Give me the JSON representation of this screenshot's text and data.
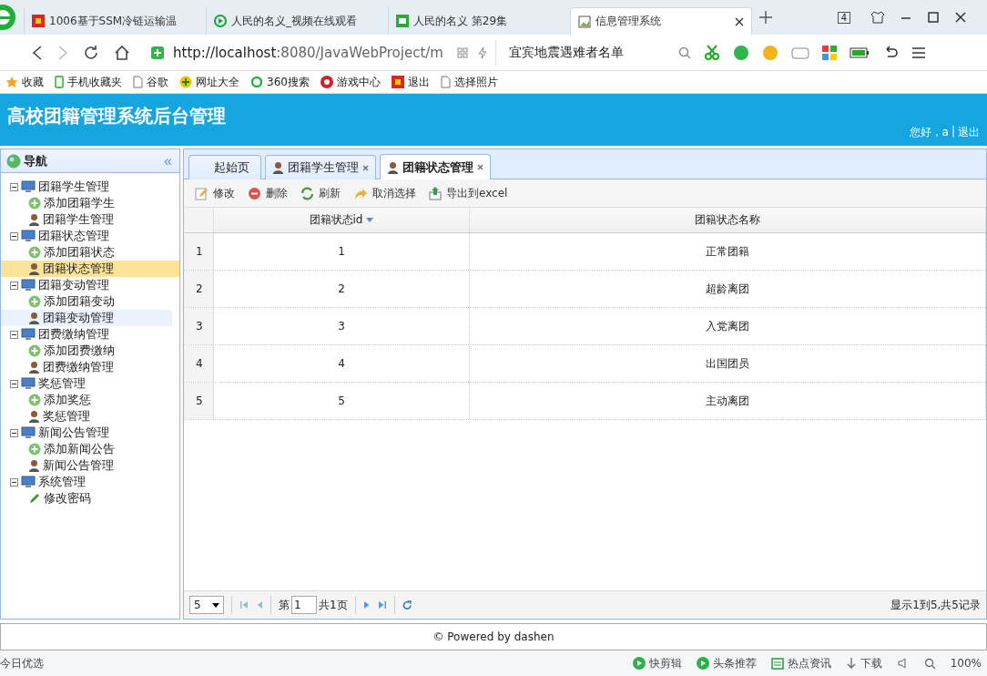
{
  "browser": {
    "tabs": [
      {
        "title": "1006基于SSM冷链运输温",
        "kind": "red",
        "selected": false
      },
      {
        "title": "人民的名义_视频在线观看",
        "kind": "play",
        "selected": false
      },
      {
        "title": "人民的名义 第29集",
        "kind": "green",
        "selected": false
      },
      {
        "title": "信息管理系统",
        "kind": "page",
        "selected": true
      }
    ],
    "tab_count": "4",
    "url_host": "http://localhost",
    "url_rest": ":8080/JavaWebProject/m",
    "search": "宜宾地震遇难者名单",
    "bookmarks": [
      {
        "label": "收藏",
        "kind": "star"
      },
      {
        "label": "手机收藏夹",
        "kind": "phone"
      },
      {
        "label": "谷歌",
        "kind": "doc"
      },
      {
        "label": "网址大全",
        "kind": "plus"
      },
      {
        "label": "360搜索",
        "kind": "ring"
      },
      {
        "label": "游戏中心",
        "kind": "game"
      },
      {
        "label": "退出",
        "kind": "red"
      },
      {
        "label": "选择照片",
        "kind": "doc"
      }
    ]
  },
  "header": {
    "title": "高校团籍管理系统后台管理",
    "greeting": "您好，a",
    "separator": "|",
    "logout": "退出"
  },
  "nav": {
    "title": "导航",
    "collapse": "«",
    "groups": [
      {
        "label": "团籍学生管理",
        "expanded": true,
        "children": [
          {
            "label": "添加团籍学生",
            "kind": "add",
            "selected": false,
            "hovered": false
          },
          {
            "label": "团籍学生管理",
            "kind": "manage",
            "selected": false,
            "hovered": false
          }
        ]
      },
      {
        "label": "团籍状态管理",
        "expanded": true,
        "children": [
          {
            "label": "添加团籍状态",
            "kind": "add",
            "selected": false,
            "hovered": false
          },
          {
            "label": "团籍状态管理",
            "kind": "manage",
            "selected": true,
            "hovered": false
          }
        ]
      },
      {
        "label": "团籍变动管理",
        "expanded": true,
        "children": [
          {
            "label": "添加团籍变动",
            "kind": "add",
            "selected": false,
            "hovered": false
          },
          {
            "label": "团籍变动管理",
            "kind": "manage",
            "selected": false,
            "hovered": true
          }
        ]
      },
      {
        "label": "团费缴纳管理",
        "expanded": true,
        "children": [
          {
            "label": "添加团费缴纳",
            "kind": "add",
            "selected": false,
            "hovered": false
          },
          {
            "label": "团费缴纳管理",
            "kind": "manage",
            "selected": false,
            "hovered": false
          }
        ]
      },
      {
        "label": "奖惩管理",
        "expanded": true,
        "children": [
          {
            "label": "添加奖惩",
            "kind": "add",
            "selected": false,
            "hovered": false
          },
          {
            "label": "奖惩管理",
            "kind": "manage",
            "selected": false,
            "hovered": false
          }
        ]
      },
      {
        "label": "新闻公告管理",
        "expanded": true,
        "children": [
          {
            "label": "添加新闻公告",
            "kind": "add",
            "selected": false,
            "hovered": false
          },
          {
            "label": "新闻公告管理",
            "kind": "manage",
            "selected": false,
            "hovered": false
          }
        ]
      },
      {
        "label": "系统管理",
        "expanded": true,
        "children": [
          {
            "label": "修改密码",
            "kind": "edit",
            "selected": false,
            "hovered": false
          }
        ]
      }
    ]
  },
  "tabs": [
    {
      "label": "起始页",
      "selected": false,
      "icon": false,
      "closable": false
    },
    {
      "label": "团籍学生管理",
      "selected": false,
      "icon": true,
      "closable": true
    },
    {
      "label": "团籍状态管理",
      "selected": true,
      "icon": true,
      "closable": true
    }
  ],
  "toolbar": [
    {
      "label": "修改",
      "kind": "edit"
    },
    {
      "label": "删除",
      "kind": "delete"
    },
    {
      "label": "刷新",
      "kind": "refresh"
    },
    {
      "label": "取消选择",
      "kind": "cancel"
    },
    {
      "label": "导出到excel",
      "kind": "export"
    }
  ],
  "table": {
    "columns": [
      {
        "label": "团籍状态id",
        "sorted": true
      },
      {
        "label": "团籍状态名称",
        "sorted": false
      }
    ],
    "rows": [
      {
        "num": "1",
        "cells": [
          "1",
          "正常团籍"
        ]
      },
      {
        "num": "2",
        "cells": [
          "2",
          "超龄离团"
        ]
      },
      {
        "num": "3",
        "cells": [
          "3",
          "入党离团"
        ]
      },
      {
        "num": "4",
        "cells": [
          "4",
          "出国团员"
        ]
      },
      {
        "num": "5",
        "cells": [
          "5",
          "主动离团"
        ]
      }
    ]
  },
  "pager": {
    "page_size": "5",
    "page_prefix": "第",
    "page": "1",
    "total": "共1页",
    "summary": "显示1到5,共5记录"
  },
  "footer": "© Powered by dashen",
  "status": {
    "left": "今日优选",
    "items": [
      {
        "label": "快剪辑",
        "kind": "play"
      },
      {
        "label": "头条推荐",
        "kind": "play"
      },
      {
        "label": "热点资讯",
        "kind": "news"
      },
      {
        "label": "下载",
        "kind": "down"
      }
    ],
    "zoom": "100%"
  }
}
